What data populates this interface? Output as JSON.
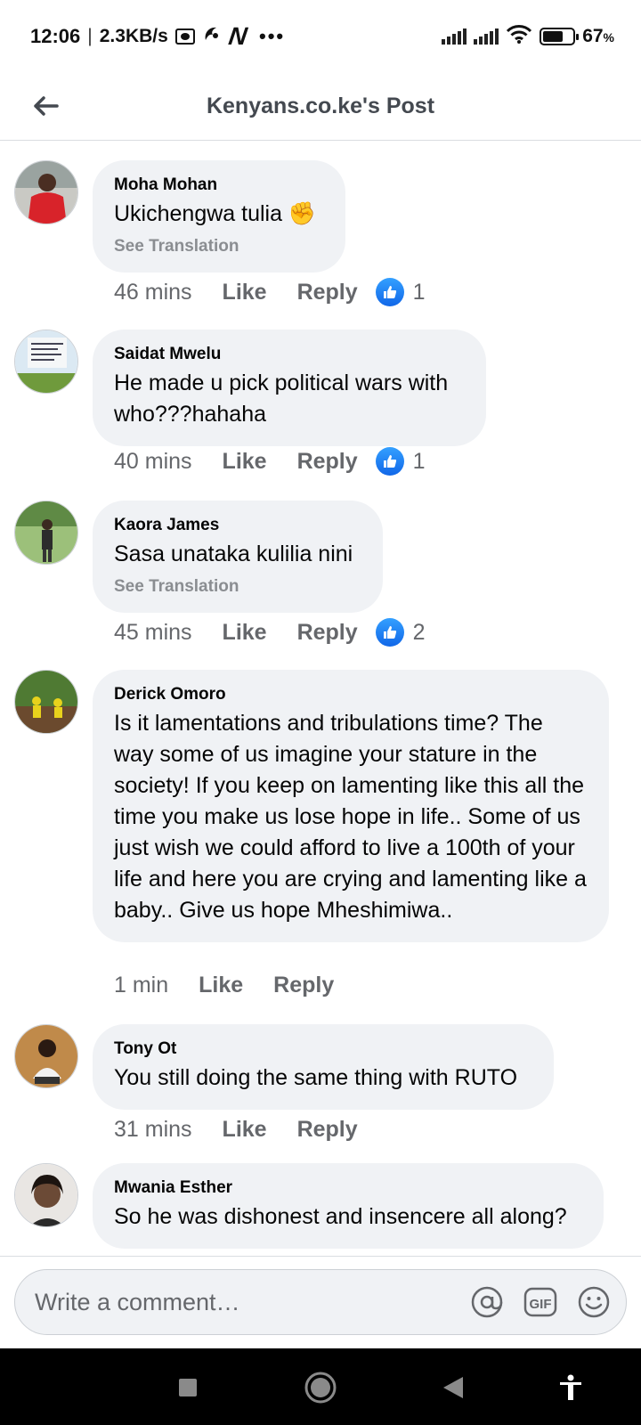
{
  "status_bar": {
    "time": "12:06",
    "separator": "|",
    "net_speed": "2.3KB/s",
    "more": "•••",
    "battery_pct": "67",
    "battery_unit": "%",
    "battery_level": 0.67
  },
  "header": {
    "title": "Kenyans.co.ke's Post",
    "back_icon": "arrow-left-icon"
  },
  "comments": [
    {
      "author": "Moha Mohan",
      "text": "Ukichengwa tulia ✊",
      "translate": "See Translation",
      "time": "46 mins",
      "like": "Like",
      "reply": "Reply",
      "reactions": "1",
      "avatar_color": "#d8232a"
    },
    {
      "author": "Saidat Mwelu",
      "text": "He made u pick political wars with who???hahaha",
      "time": "40 mins",
      "like": "Like",
      "reply": "Reply",
      "reactions": "1",
      "avatar_color": "#7fb3d9"
    },
    {
      "author": "Kaora James",
      "text": "Sasa unataka kulilia nini",
      "translate": "See Translation",
      "time": "45 mins",
      "like": "Like",
      "reply": "Reply",
      "reactions": "2",
      "avatar_color": "#6d9a4c"
    },
    {
      "author": "Derick Omoro",
      "text": "Is it lamentations and tribulations time? The way some of us imagine your stature in the society! If you keep on lamenting like this all the time you make us lose hope in life.. Some of us just wish we could afford to live a 100th of your life and here you are crying and lamenting like a baby.. Give us hope Mheshimiwa..",
      "time": "1 min",
      "like": "Like",
      "reply": "Reply",
      "avatar_color": "#5c8a3a"
    },
    {
      "author": "Tony Ot",
      "text": "You still doing the same thing with RUTO",
      "time": "31 mins",
      "like": "Like",
      "reply": "Reply",
      "avatar_color": "#b8884a"
    },
    {
      "author": "Mwania Esther",
      "text": "So he was dishonest and insencere all along?",
      "avatar_color": "#c9a27a"
    }
  ],
  "composer": {
    "placeholder": "Write a comment…",
    "mention_icon": "at-icon",
    "gif_icon": "gif-icon",
    "gif_label": "GIF",
    "emoji_icon": "smiley-icon"
  },
  "colors": {
    "bubble": "#f0f2f5",
    "meta_text": "#65676b",
    "like_blue": "#1877f2"
  }
}
